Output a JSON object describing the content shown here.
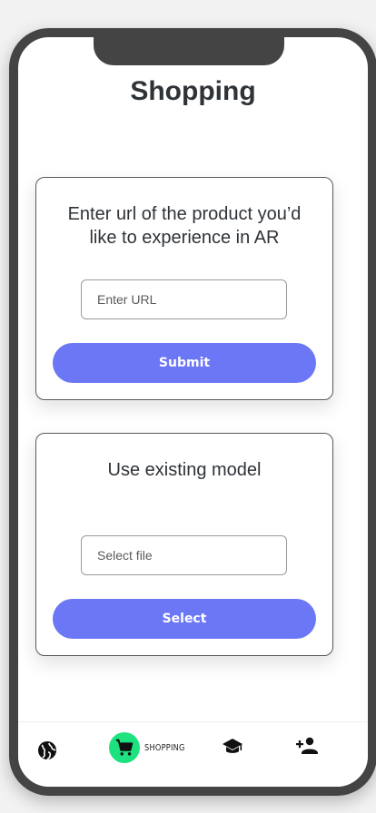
{
  "app": {
    "title": "Shopping"
  },
  "url_card": {
    "prompt": "Enter url of the product you’d like to experience in AR",
    "input_placeholder": "Enter URL",
    "button_label": "Submit"
  },
  "model_card": {
    "prompt": "Use existing model",
    "input_placeholder": "Select file",
    "button_label": "Select"
  },
  "bottom_nav": {
    "items": [
      {
        "icon": "globe-icon",
        "label": ""
      },
      {
        "icon": "shopping-cart-icon",
        "label": "SHOPPING",
        "active": true
      },
      {
        "icon": "graduation-cap-icon",
        "label": ""
      },
      {
        "icon": "add-person-icon",
        "label": ""
      }
    ],
    "active_color": "#1de27f"
  },
  "colors": {
    "accent": "#6b77f5",
    "frame": "#444444",
    "text": "#2e3338"
  }
}
